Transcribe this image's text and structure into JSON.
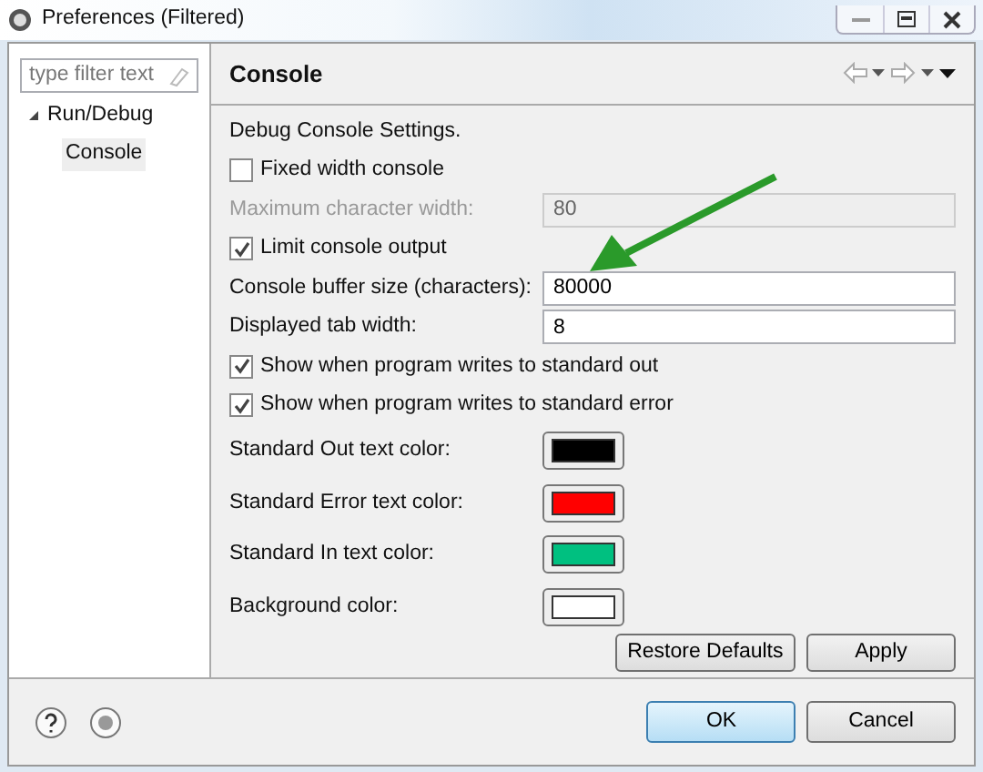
{
  "window": {
    "title": "Preferences (Filtered)"
  },
  "sidebar": {
    "filter": {
      "placeholder": "type filter text"
    },
    "tree": [
      {
        "label": "Run/Debug",
        "expanded": true,
        "selected": false,
        "children": [
          {
            "label": "Console",
            "selected": true
          }
        ]
      }
    ]
  },
  "page": {
    "title": "Console",
    "description": "Debug Console Settings.",
    "settings": [
      {
        "kind": "checkbox",
        "label": "Fixed width console",
        "checked": false
      },
      {
        "kind": "field",
        "label": "Maximum character width:",
        "value": "80",
        "disabled": true
      },
      {
        "kind": "checkbox",
        "label": "Limit console output",
        "checked": true
      },
      {
        "kind": "field",
        "label": "Console buffer size (characters):",
        "value": "80000",
        "disabled": false
      },
      {
        "kind": "field",
        "label": "Displayed tab width:",
        "value": "8",
        "disabled": false
      },
      {
        "kind": "checkbox",
        "label": "Show when program writes to standard out",
        "checked": true
      },
      {
        "kind": "checkbox",
        "label": "Show when program writes to standard error",
        "checked": true
      },
      {
        "kind": "color",
        "label": "Standard Out text color:",
        "color": "#000000"
      },
      {
        "kind": "color",
        "label": "Standard Error text color:",
        "color": "#ff0000"
      },
      {
        "kind": "color",
        "label": "Standard In text color:",
        "color": "#00c080"
      },
      {
        "kind": "color",
        "label": "Background color:",
        "color": "#ffffff"
      }
    ],
    "buttons": [
      "Restore Defaults",
      "Apply"
    ]
  },
  "dialog_buttons": [
    {
      "label": "OK",
      "default": true
    },
    {
      "label": "Cancel",
      "default": false
    }
  ]
}
